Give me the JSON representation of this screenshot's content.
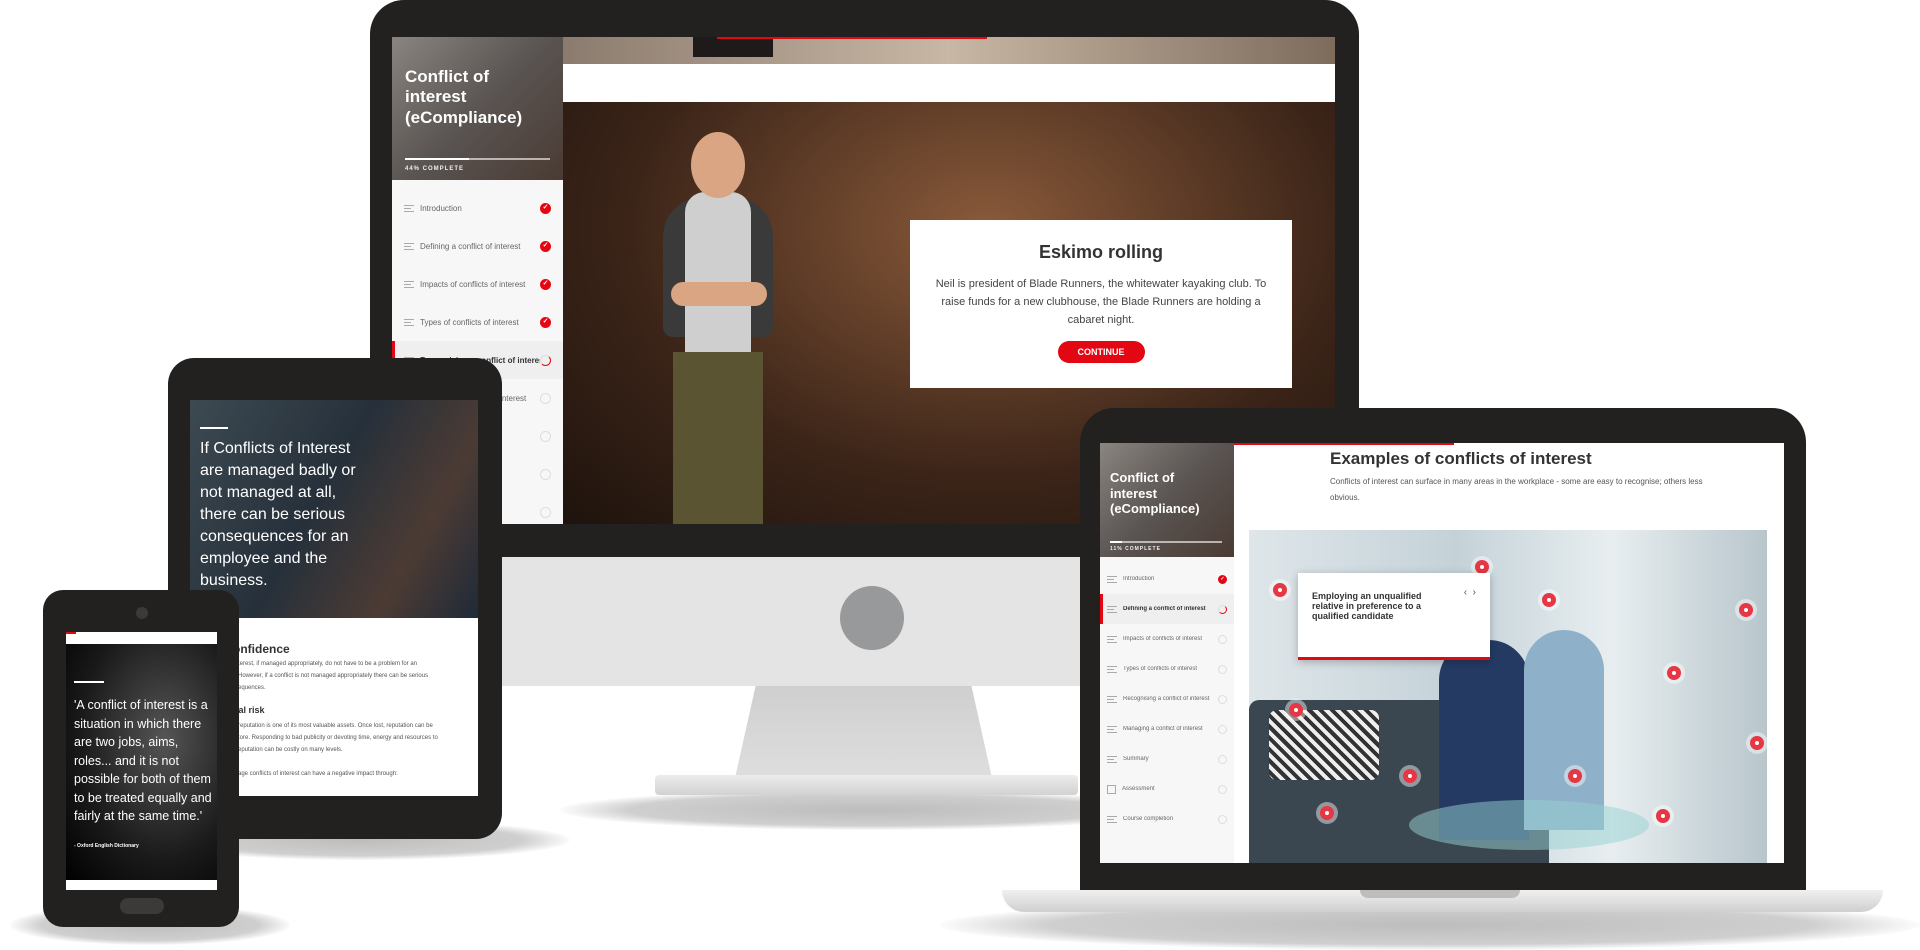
{
  "course_title": "Conflict of interest (eCompliance)",
  "colors": {
    "accent": "#e30613",
    "device": "#232120"
  },
  "desktop": {
    "progress_percent": 44,
    "progress_label": "44% COMPLETE",
    "nav": [
      {
        "label": "Introduction",
        "status": "complete"
      },
      {
        "label": "Defining a conflict of interest",
        "status": "complete"
      },
      {
        "label": "Impacts of conflicts of interest",
        "status": "complete"
      },
      {
        "label": "Types of conflicts of interest",
        "status": "complete"
      },
      {
        "label": "Recognising a conflict of interest",
        "status": "in-progress"
      },
      {
        "label": "Managing a conflict of interest",
        "status": "not-started"
      },
      {
        "label": "",
        "status": "not-started"
      },
      {
        "label": "",
        "status": "not-started"
      },
      {
        "label": "",
        "status": "not-started"
      }
    ],
    "dialog": {
      "title": "Eskimo rolling",
      "body": "Neil is president of Blade Runners, the whitewater kayaking club. To raise funds for a new clubhouse, the Blade Runners are holding a cabaret night.",
      "button": "CONTINUE"
    }
  },
  "tablet": {
    "hero_text": "If Conflicts of Interest are managed badly or not managed at all, there can be serious consequences for an employee and the business.",
    "heading1": "onfidence",
    "para1": [
      "terest, if managed appropriately, do not have to be a problem for an",
      "However, if a conflict is not managed appropriately there can be serious",
      "equences."
    ],
    "heading2": "nal risk",
    "para2": [
      "reputation is one of its most valuable assets. Once lost, reputation can be",
      "tore. Responding to bad publicity or devoting time, energy and resources to",
      "eputation can be costly on many levels."
    ],
    "para3": "age conflicts of interest can have a negative impact through:"
  },
  "phone": {
    "quote": "'A conflict of interest is a situation in which there are two jobs, aims, roles... and it is not possible for both of them to be treated equally and fairly at the same time.'",
    "source": "- Oxford English Dictionary"
  },
  "laptop": {
    "progress_percent": 11,
    "progress_label": "11% COMPLETE",
    "nav": [
      {
        "label": "Introduction",
        "status": "complete"
      },
      {
        "label": "Defining a conflict of interest",
        "status": "in-progress"
      },
      {
        "label": "Impacts of conflicts of interest",
        "status": "not-started"
      },
      {
        "label": "Types of conflicts of interest",
        "status": "not-started"
      },
      {
        "label": "Recognising a conflict of interest",
        "status": "not-started"
      },
      {
        "label": "Managing a conflict of interest",
        "status": "not-started"
      },
      {
        "label": "Summary",
        "status": "not-started"
      },
      {
        "label": "Assessment",
        "status": "not-started",
        "icon": "question-box-icon"
      },
      {
        "label": "Course completion",
        "status": "not-started"
      }
    ],
    "page_title": "Examples of conflicts of interest",
    "page_desc": "Conflicts of interest can surface in many areas in the workplace - some are easy to recognise; others less obvious.",
    "popup_text": "Employing an unqualified relative in preference to a qualified candidate",
    "popup_prev": "‹",
    "popup_next": "›"
  }
}
